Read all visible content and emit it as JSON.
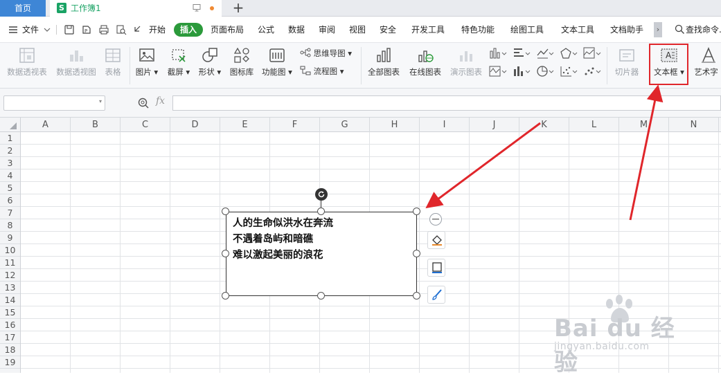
{
  "titlebar": {
    "home_tab": "首页",
    "doc_tab_icon": "S",
    "doc_tab": "工作簿1",
    "new_tab": "+"
  },
  "menubar": {
    "file": "文件",
    "items": [
      "开始",
      "插入",
      "页面布局",
      "公式",
      "数据",
      "审阅",
      "视图",
      "安全",
      "开发工具",
      "特色功能",
      "绘图工具",
      "文本工具",
      "文档助手"
    ],
    "active": "插入",
    "more": "›",
    "search": "查找命令..."
  },
  "ribbon": {
    "pivot_table": "数据透视表",
    "pivot_chart": "数据透视图",
    "table": "表格",
    "picture": "图片",
    "screenshot": "截屏",
    "shape": "形状",
    "icon_lib": "图标库",
    "function_chart": "功能图",
    "mindmap": "思维导图",
    "flowchart": "流程图",
    "all_charts": "全部图表",
    "online_chart": "在线图表",
    "demo_chart": "演示图表",
    "slicer": "切片器",
    "textbox": "文本框",
    "wordart": "艺术字"
  },
  "formulabar": {
    "name_box": "",
    "fx": "fx",
    "formula": ""
  },
  "grid": {
    "columns": [
      "A",
      "B",
      "C",
      "D",
      "E",
      "F",
      "G",
      "H",
      "I",
      "J",
      "K",
      "L",
      "M",
      "N"
    ],
    "rows": [
      "1",
      "2",
      "3",
      "4",
      "5",
      "6",
      "7",
      "8",
      "9",
      "10",
      "11",
      "12",
      "13",
      "14",
      "15",
      "16",
      "17",
      "18",
      "19"
    ]
  },
  "textbox": {
    "lines": [
      "人的生命似洪水在奔流",
      "不遇着岛屿和暗礁",
      "难以激起美丽的浪花"
    ]
  },
  "annotation": {
    "color": "#e0262b"
  },
  "watermark": {
    "brand": "Bai du 经验",
    "url": "jingyan.baidu.com"
  }
}
